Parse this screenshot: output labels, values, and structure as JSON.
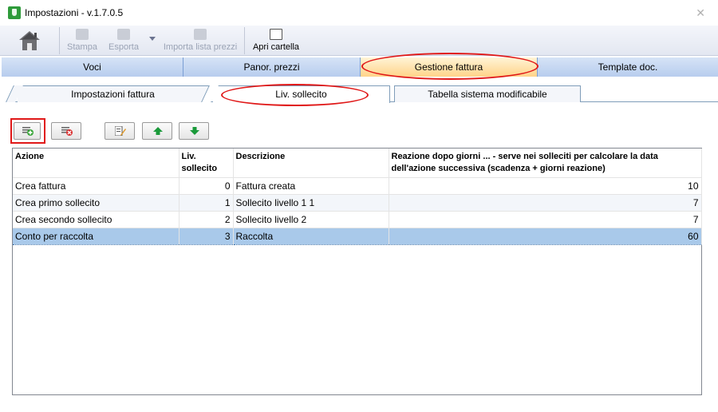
{
  "window": {
    "title": "Impostazioni  -  v.1.7.0.5",
    "close_glyph": "✕"
  },
  "toolbar": {
    "print_label": "Stampa",
    "export_label": "Esporta",
    "import_label": "Importa lista prezzi",
    "open_folder_label": "Apri cartella"
  },
  "main_tabs": [
    {
      "label": "Voci"
    },
    {
      "label": "Panor. prezzi"
    },
    {
      "label": "Gestione fattura"
    },
    {
      "label": "Template doc."
    }
  ],
  "sub_tabs": [
    {
      "label": "Impostazioni fattura"
    },
    {
      "label": "Liv. sollecito"
    },
    {
      "label": "Tabella sistema modificabile"
    }
  ],
  "actions": {
    "add": "add-row-icon",
    "delete": "delete-row-icon",
    "edit": "edit-icon",
    "up": "arrow-up-icon",
    "down": "arrow-down-icon"
  },
  "table": {
    "columns": [
      "Azione",
      "Liv. sollecito",
      "Descrizione",
      "Reazione dopo giorni ... - serve nei solleciti per calcolare la data dell'azione successiva (scadenza + giorni reazione)"
    ],
    "rows": [
      {
        "azione": "Crea fattura",
        "livello": "0",
        "descrizione": "Fattura creata",
        "reazione": "10"
      },
      {
        "azione": "Crea primo sollecito",
        "livello": "1",
        "descrizione": "Sollecito livello 1 1",
        "reazione": "7"
      },
      {
        "azione": "Crea secondo sollecito",
        "livello": "2",
        "descrizione": "Sollecito livello 2",
        "reazione": "7"
      },
      {
        "azione": "Conto per raccolta",
        "livello": "3",
        "descrizione": "Raccolta",
        "reazione": "60"
      }
    ],
    "selected_row": 3
  },
  "colors": {
    "accent": "#4a86d6",
    "highlight": "#e01818",
    "selection": "#a9c9ea"
  }
}
